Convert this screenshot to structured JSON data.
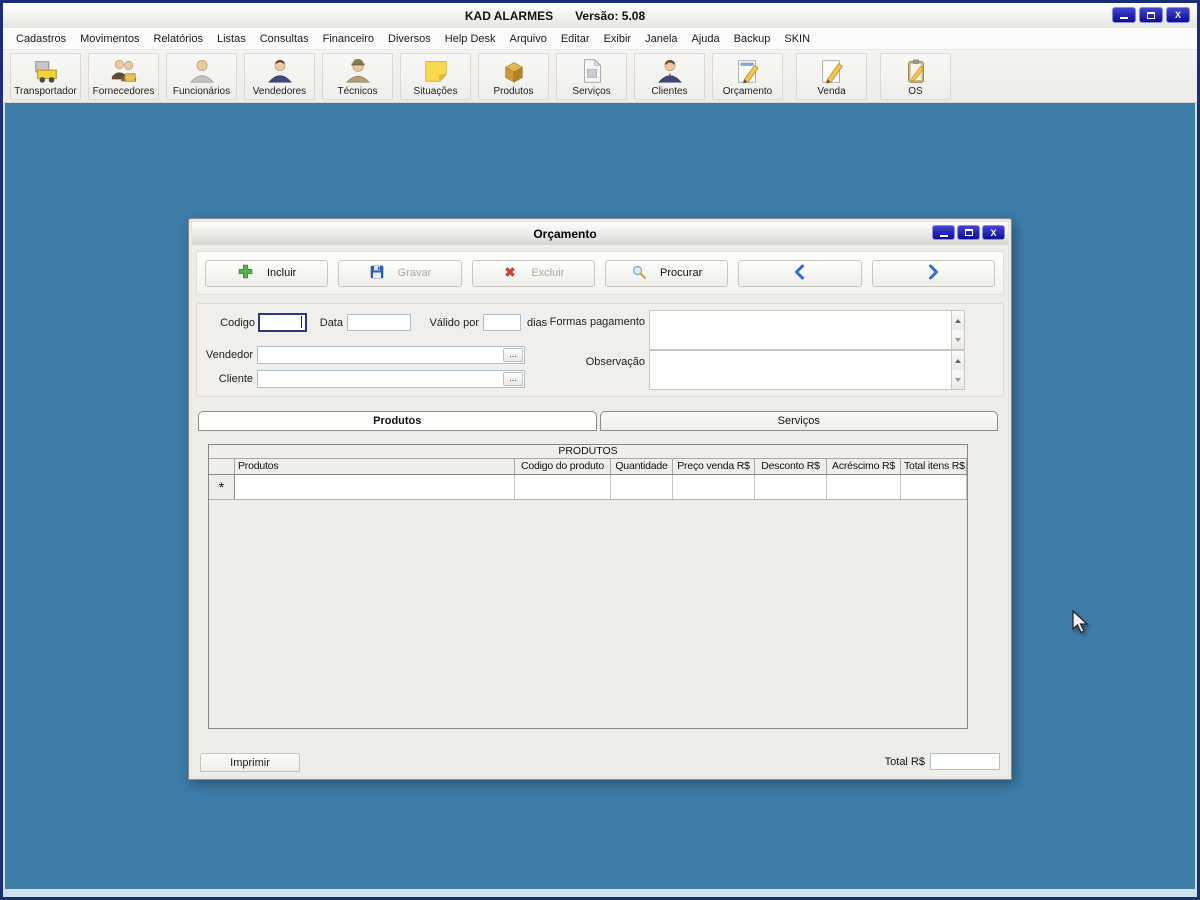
{
  "main_window": {
    "title": "KAD ALARMES",
    "version": "Versão: 5.08",
    "controls": {
      "minimize_icon": "minimize-icon",
      "maximize_icon": "maximize-icon",
      "close_glyph": "X"
    }
  },
  "menu": {
    "items": [
      "Cadastros",
      "Movimentos",
      "Relatórios",
      "Listas",
      "Consultas",
      "Financeiro",
      "Diversos",
      "Help Desk",
      "Arquivo",
      "Editar",
      "Exibir",
      "Janela",
      "Ajuda",
      "Backup",
      "SKIN"
    ]
  },
  "toolbar": {
    "buttons": [
      {
        "label": "Transportador",
        "icon": "truck-icon"
      },
      {
        "label": "Fornecedores",
        "icon": "suppliers-icon"
      },
      {
        "label": "Funcionários",
        "icon": "employee-icon"
      },
      {
        "label": "Vendedores",
        "icon": "salesperson-icon"
      },
      {
        "label": "Técnicos",
        "icon": "technician-icon"
      },
      {
        "label": "Situações",
        "icon": "sticky-note-icon"
      },
      {
        "label": "Produtos",
        "icon": "box-icon"
      },
      {
        "label": "Serviços",
        "icon": "document-icon"
      },
      {
        "label": "Clientes",
        "icon": "client-icon"
      },
      {
        "label": "Orçamento",
        "icon": "document-pencil-icon"
      },
      {
        "label": "Venda",
        "icon": "document-pencil-icon"
      },
      {
        "label": "OS",
        "icon": "clipboard-pencil-icon"
      }
    ]
  },
  "dialog": {
    "title": "Orçamento",
    "controls": {
      "close_glyph": "X"
    },
    "actions": [
      {
        "label": "Incluir",
        "icon": "plus-icon",
        "enabled": true
      },
      {
        "label": "Gravar",
        "icon": "save-icon",
        "enabled": false
      },
      {
        "label": "Excluir",
        "icon": "delete-icon",
        "enabled": false
      },
      {
        "label": "Procurar",
        "icon": "search-icon",
        "enabled": true
      }
    ],
    "nav": {
      "prev_icon": "chevron-left-icon",
      "next_icon": "chevron-right-icon"
    },
    "fields": {
      "codigo": {
        "label": "Codigo",
        "value": ""
      },
      "data": {
        "label": "Data",
        "value": ""
      },
      "valido_por": {
        "label": "Válido por",
        "value": "",
        "suffix": "dias"
      },
      "formas_pagamento": {
        "label": "Formas pagamento",
        "value": ""
      },
      "vendedor": {
        "label": "Vendedor",
        "value": "",
        "picker": "..."
      },
      "cliente": {
        "label": "Cliente",
        "value": "",
        "picker": "..."
      },
      "observacao": {
        "label": "Observação",
        "value": ""
      }
    },
    "tabs": [
      {
        "label": "Produtos",
        "active": true
      },
      {
        "label": "Serviços",
        "active": false
      }
    ],
    "grid": {
      "title": "PRODUTOS",
      "columns": [
        "Produtos",
        "Codigo do produto",
        "Quantidade",
        "Preço venda R$",
        "Desconto R$",
        "Acréscimo R$",
        "Total itens R$"
      ],
      "new_row_marker": "*"
    },
    "footer": {
      "imprimir": "Imprimir",
      "total_label": "Total R$",
      "total_value": ""
    }
  },
  "colors": {
    "desktop": "#3e7ca8",
    "frame": "#1b2d74",
    "titlebar_button": "#1414a8",
    "accent_blue": "#2a6fd0"
  }
}
